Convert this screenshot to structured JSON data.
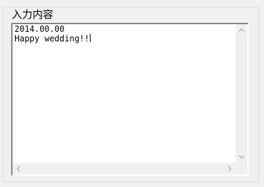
{
  "groupbox": {
    "title": "入力内容"
  },
  "textarea": {
    "lines": [
      "2014.00.00",
      "Happy wedding!!"
    ]
  },
  "scrollbars": {
    "vertical": {
      "up_icon": "chevron-up-icon",
      "down_icon": "chevron-down-icon"
    },
    "horizontal": {
      "left_icon": "chevron-left-icon",
      "right_icon": "chevron-right-icon"
    },
    "arrow_color": "#a3a3a3"
  }
}
